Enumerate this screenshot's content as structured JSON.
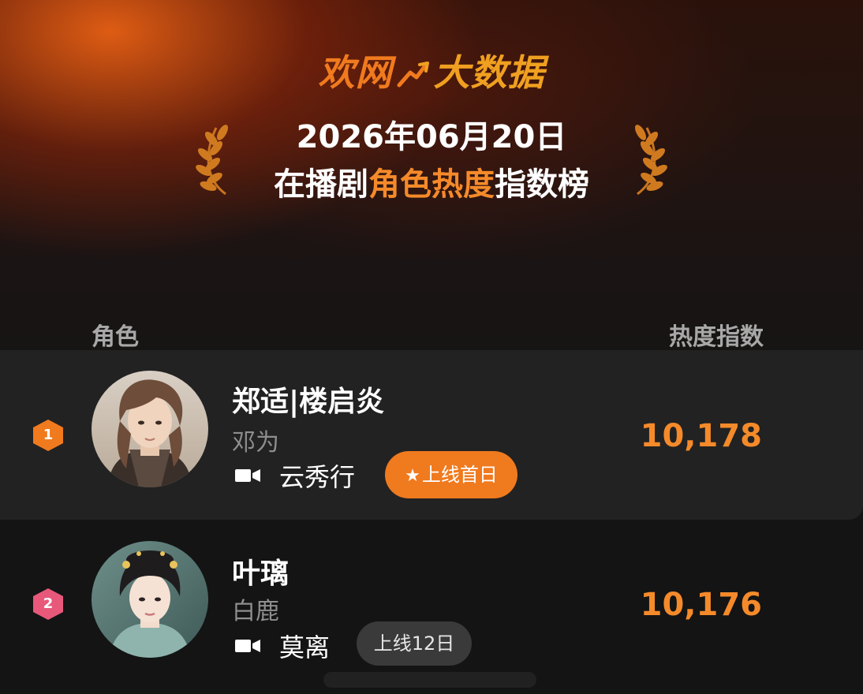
{
  "brand": {
    "part1": "欢网",
    "part2": "大数据"
  },
  "heading": {
    "date": "2026年06月20日",
    "title_prefix": "在播剧",
    "title_accent": "角色热度",
    "title_suffix": "指数榜"
  },
  "columns": {
    "role": "角色",
    "score": "热度指数"
  },
  "colors": {
    "accent": "#f58a2a",
    "rank1": "#f07a1e",
    "rank2": "#e8587a",
    "badge_premiere": "#f07a1e",
    "badge_days": "#3a3a3a"
  },
  "rows": [
    {
      "rank": "1",
      "role": "郑适|楼启炎",
      "actor": "邓为",
      "drama": "云秀行",
      "badge": "上线首日",
      "badge_icon": "star-icon",
      "score": "10,178"
    },
    {
      "rank": "2",
      "role": "叶璃",
      "actor": "白鹿",
      "drama": "莫离",
      "badge": "上线12日",
      "score": "10,176"
    }
  ]
}
